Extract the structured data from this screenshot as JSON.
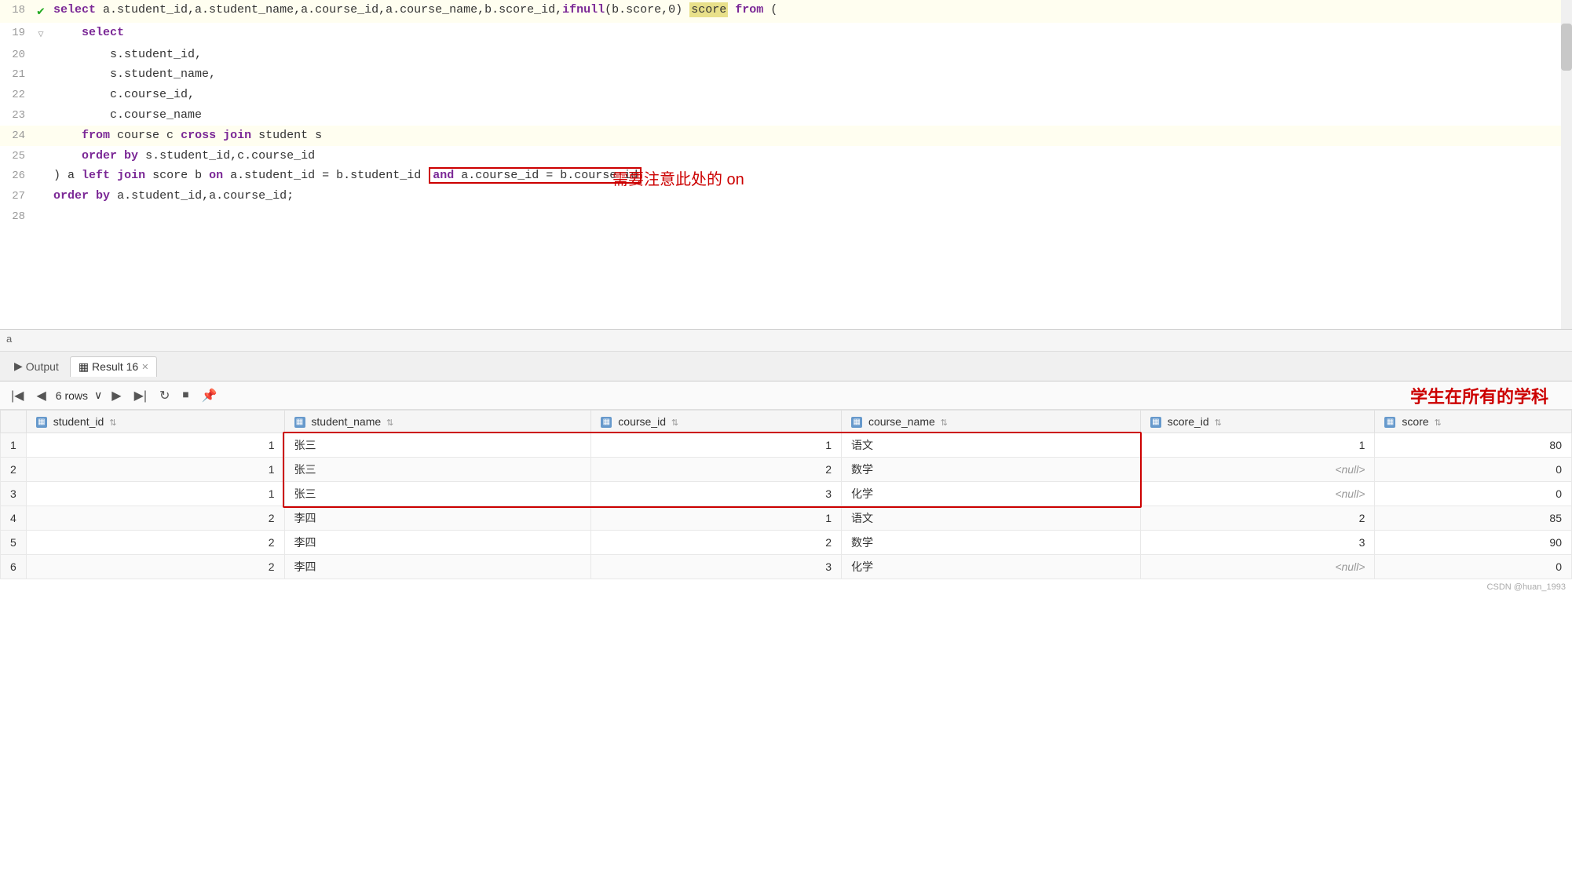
{
  "editor": {
    "lines": [
      {
        "num": 18,
        "hasCheck": true,
        "hasFold": false,
        "content_html": "<span class='kw-select'>select</span> <span class='plain'>a.student_id,a.student_name,a.course_id,a.course_name,b.score_id,</span><span class='fn-ifnull'>ifnull</span><span class='plain'>(b.score,0)</span> <span class='highlight-score'>score</span> <span class='kw-from'>from</span> <span class='plain'>(</span>"
      },
      {
        "num": 19,
        "hasCheck": false,
        "hasFold": true,
        "content_html": "    <span class='kw-select'>select</span>"
      },
      {
        "num": 20,
        "hasCheck": false,
        "hasFold": false,
        "content_html": "        <span class='plain'>s.student_id,</span>"
      },
      {
        "num": 21,
        "hasCheck": false,
        "hasFold": false,
        "content_html": "        <span class='plain'>s.student_name,</span>"
      },
      {
        "num": 22,
        "hasCheck": false,
        "hasFold": false,
        "content_html": "        <span class='plain'>c.course_id,</span>"
      },
      {
        "num": 23,
        "hasCheck": false,
        "hasFold": false,
        "content_html": "        <span class='plain'>c.course_name</span>"
      },
      {
        "num": 24,
        "hasCheck": false,
        "hasFold": false,
        "highlight": true,
        "content_html": "    <span class='kw-from'>from</span> <span class='plain'>course c</span> <span class='kw-cross'>cross</span> <span class='kw-join'>join</span> <span class='plain'>student s</span>"
      },
      {
        "num": 25,
        "hasCheck": false,
        "hasFold": false,
        "content_html": "    <span class='kw-order'>order</span> <span class='kw-by'>by</span> <span class='plain'>s.student_id,c.course_id</span>"
      },
      {
        "num": 26,
        "hasCheck": false,
        "hasFold": false,
        "content_html": "<span class='plain'>) a</span> <span class='kw-left'>left</span> <span class='kw-join'>join</span> <span class='plain'>score b</span> <span class='kw-on'>on</span> <span class='plain'>a.student_id = b.student_id</span> <span class='and-highlight'><span class='kw-and'>and</span> <span class='plain'>a.course_id = b.course_id</span></span>"
      },
      {
        "num": 27,
        "hasCheck": false,
        "hasFold": false,
        "content_html": "<span class='kw-order'>order</span> <span class='kw-by'>by</span> <span class='plain'>a.student_id,a.course_id;</span>"
      },
      {
        "num": 28,
        "hasCheck": false,
        "hasFold": false,
        "content_html": ""
      }
    ],
    "annotation_text": "需要注意此处的 on",
    "tab_label": "a"
  },
  "bottom_panel": {
    "tabs": [
      {
        "id": "output",
        "label": "Output",
        "icon": "▶",
        "active": false
      },
      {
        "id": "result16",
        "label": "Result 16",
        "active": true,
        "closeable": true
      }
    ],
    "toolbar": {
      "rows_label": "6 rows",
      "annotation_title": "学生在所有的学科"
    },
    "result_table": {
      "columns": [
        {
          "id": "student_id",
          "label": "student_id"
        },
        {
          "id": "student_name",
          "label": "student_name"
        },
        {
          "id": "course_id",
          "label": "course_id"
        },
        {
          "id": "course_name",
          "label": "course_name"
        },
        {
          "id": "score_id",
          "label": "score_id"
        },
        {
          "id": "score",
          "label": "score"
        }
      ],
      "rows": [
        {
          "num": 1,
          "student_id": "1",
          "student_name": "张三",
          "course_id": "1",
          "course_name": "语文",
          "score_id": "1",
          "score": "80"
        },
        {
          "num": 2,
          "student_id": "1",
          "student_name": "张三",
          "course_id": "2",
          "course_name": "数学",
          "score_id": "<null>",
          "score": "0"
        },
        {
          "num": 3,
          "student_id": "1",
          "student_name": "张三",
          "course_id": "3",
          "course_name": "化学",
          "score_id": "<null>",
          "score": "0"
        },
        {
          "num": 4,
          "student_id": "2",
          "student_name": "李四",
          "course_id": "1",
          "course_name": "语文",
          "score_id": "2",
          "score": "85"
        },
        {
          "num": 5,
          "student_id": "2",
          "student_name": "李四",
          "course_id": "2",
          "course_name": "数学",
          "score_id": "3",
          "score": "90"
        },
        {
          "num": 6,
          "student_id": "2",
          "student_name": "李四",
          "course_id": "3",
          "course_name": "化学",
          "score_id": "<null>",
          "score": "0"
        }
      ]
    }
  },
  "watermark": "CSDN @huan_1993"
}
